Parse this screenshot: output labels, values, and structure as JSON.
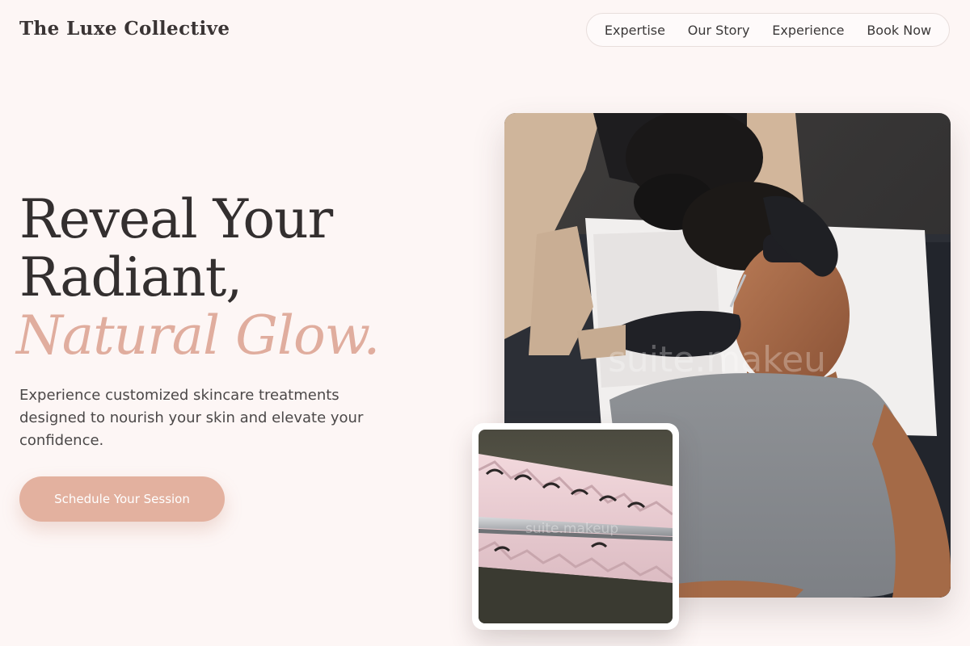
{
  "brand": {
    "logo_text": "The Luxe Collective"
  },
  "nav": {
    "items": [
      "Expertise",
      "Our Story",
      "Experience",
      "Book Now"
    ]
  },
  "hero": {
    "title_line1": "Reveal Your",
    "title_line2": "Radiant,",
    "title_accent": "Natural Glow.",
    "subtitle": "Experience customized skincare treatments designed to nourish your skin and elevate your confidence.",
    "cta_label": "Schedule Your Session"
  },
  "images": {
    "main_watermark": "suite.makeu",
    "thumb_watermark": "suite.makeup"
  },
  "colors": {
    "background": "#fdf6f5",
    "accent": "#e0ad9e",
    "button": "#e3b19f",
    "text": "#332f2f"
  }
}
